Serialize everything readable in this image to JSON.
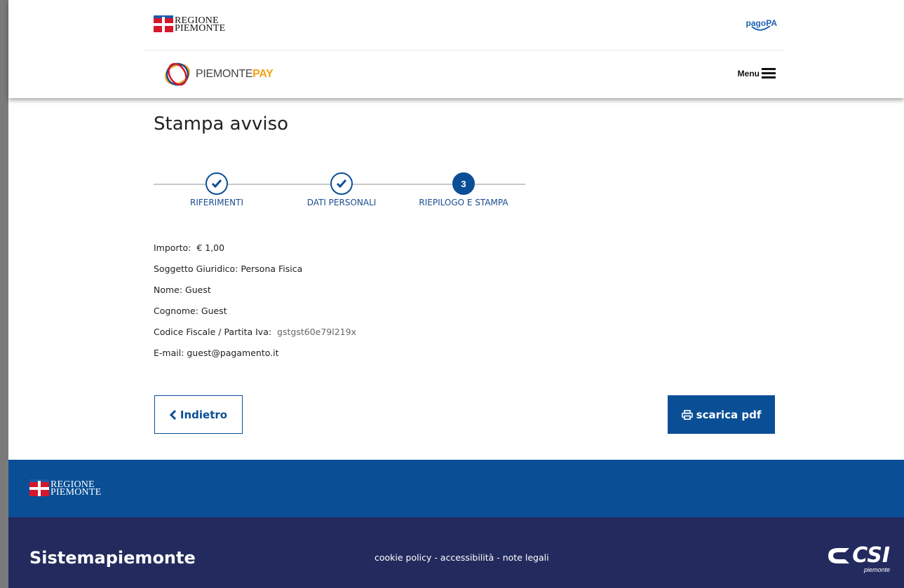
{
  "header": {
    "region_logo_line1": "REGIONE",
    "region_logo_line2": "PIEMONTE",
    "pagopa_label": "pagoPA",
    "app_logo_prefix": "PIEMONTE",
    "app_logo_suffix": "PAY",
    "menu_label": "Menu"
  },
  "main": {
    "title": "Stampa avviso",
    "steps": [
      {
        "label": "RIFERIMENTI",
        "state": "done"
      },
      {
        "label": "DATI PERSONALI",
        "state": "done"
      },
      {
        "label": "RIEPILOGO E STAMPA",
        "state": "active",
        "number": "3"
      }
    ],
    "summary": {
      "importo_label": "Importo:",
      "importo_value": "€ 1,00",
      "soggetto": "Soggetto Giuridico: Persona Fisica",
      "nome": "Nome: Guest",
      "cognome": "Cognome: Guest",
      "cf_label": "Codice Fiscale / Partita Iva:",
      "cf_value": "gstgst60e79l219x",
      "email": "E-mail: guest@pagamento.it"
    },
    "back_label": "Indietro",
    "pdf_label": "scarica pdf"
  },
  "footer": {
    "region_logo_line1": "REGIONE",
    "region_logo_line2": "PIEMONTE",
    "brand": "Sistemapiemonte",
    "links": "cookie policy - accessibilità - note legali",
    "csi_logo": "CSI",
    "csi_sub": "piemonte"
  },
  "colors": {
    "primary": "#0a4f96",
    "footer_dark": "#232b5e",
    "accent_pay": "#f2a31a",
    "region_red": "#d5172b"
  }
}
